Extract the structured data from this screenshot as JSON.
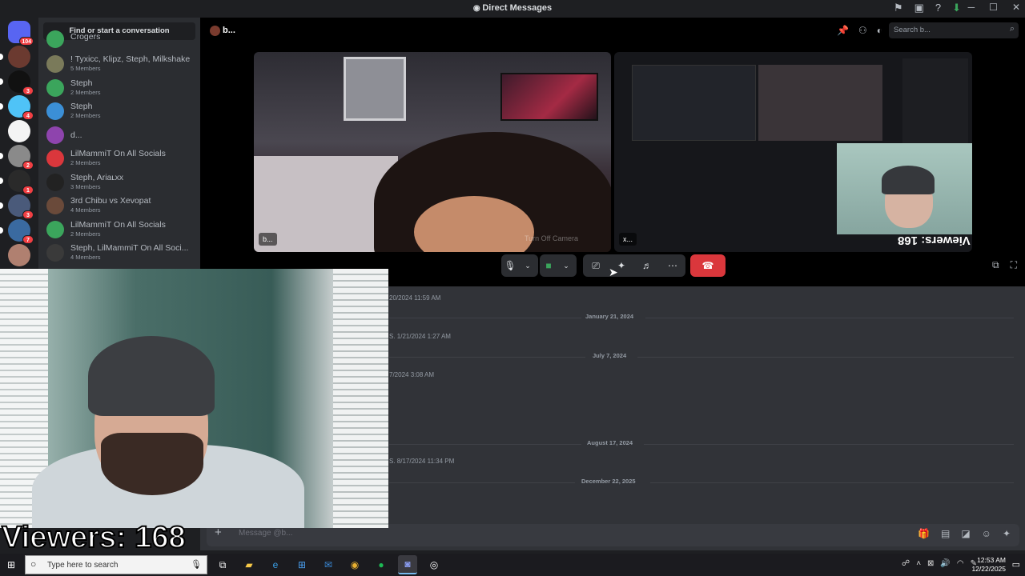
{
  "window": {
    "title": "Direct Messages"
  },
  "titlebar_icons": [
    "flag-icon",
    "inbox-icon",
    "help-icon",
    "download-icon"
  ],
  "window_controls": {
    "minimize": "─",
    "maximize": "☐",
    "close": "✕"
  },
  "guilds": [
    {
      "badge": "104",
      "color": "#5865f2"
    },
    {
      "badge": "",
      "color": "#6b3a30"
    },
    {
      "badge": "3",
      "color": "#111111"
    },
    {
      "badge": "4",
      "color": "#4fc3f7"
    },
    {
      "badge": "",
      "color": "#f4f4f4"
    },
    {
      "badge": "2",
      "color": "#8a8a8a"
    },
    {
      "badge": "1",
      "color": "#2a2a2a"
    },
    {
      "badge": "3",
      "color": "#4a5a7a"
    },
    {
      "badge": "7",
      "color": "#3a6aa0"
    },
    {
      "badge": "",
      "color": "#b08070"
    }
  ],
  "dm_sidebar": {
    "search_label": "Find or start a conversation",
    "items": [
      {
        "name": "Crogers",
        "sub": "",
        "color": "#3ba55c"
      },
      {
        "name": "! Tyxicc, Klipz, Steph, Milkshake",
        "sub": "5 Members",
        "color": "#7a7a5a"
      },
      {
        "name": "Steph",
        "sub": "2 Members",
        "color": "#3ba55c"
      },
      {
        "name": "Steph",
        "sub": "2 Members",
        "color": "#3b8fd6"
      },
      {
        "name": "d...",
        "sub": "",
        "color": "#8e44ad"
      },
      {
        "name": "LilMammiT On All Socials",
        "sub": "2 Members",
        "color": "#da373c"
      },
      {
        "name": "Steph, Ariaʟxx",
        "sub": "3 Members",
        "color": "#222222"
      },
      {
        "name": "3rd Chibu vs Xevopat",
        "sub": "4 Members",
        "color": "#6a4a3a"
      },
      {
        "name": "LilMammiT On All Socials",
        "sub": "2 Members",
        "color": "#3ba55c"
      },
      {
        "name": "Steph, LilMammiT On All Soci...",
        "sub": "4 Members",
        "color": "#3a3a3a"
      }
    ]
  },
  "call": {
    "channel_name": "b...",
    "search_placeholder": "Search b...",
    "tiles": [
      {
        "label": "b...",
        "overlay": "Turn Off Camera"
      },
      {
        "label": "x...",
        "viewers": "Viewers: 168"
      }
    ],
    "controls": [
      "mic-icon",
      "chevron-down-icon",
      "camera-icon",
      "chevron-down-icon",
      "screen-share-icon",
      "activities-icon",
      "soundboard-icon",
      "more-icon"
    ],
    "hangup_icon": "☎"
  },
  "chat": {
    "dividers": [
      {
        "date": "January 21, 2024"
      },
      {
        "date": "July 7, 2024"
      },
      {
        "date": "August 17, 2024"
      },
      {
        "date": "December 22, 2025"
      }
    ],
    "system_lines": [
      "20/2024 11:59 AM",
      "S. 1/21/2024 1:27 AM",
      "7/2024 3:08 AM",
      "S. 8/17/2024 11:34 PM"
    ],
    "composer_placeholder": "Message @b..."
  },
  "overlay": {
    "viewers": "Viewers: 168"
  },
  "taskbar": {
    "search_placeholder": "Type here to search",
    "time": "12:53 AM",
    "date": "12/22/2025"
  }
}
